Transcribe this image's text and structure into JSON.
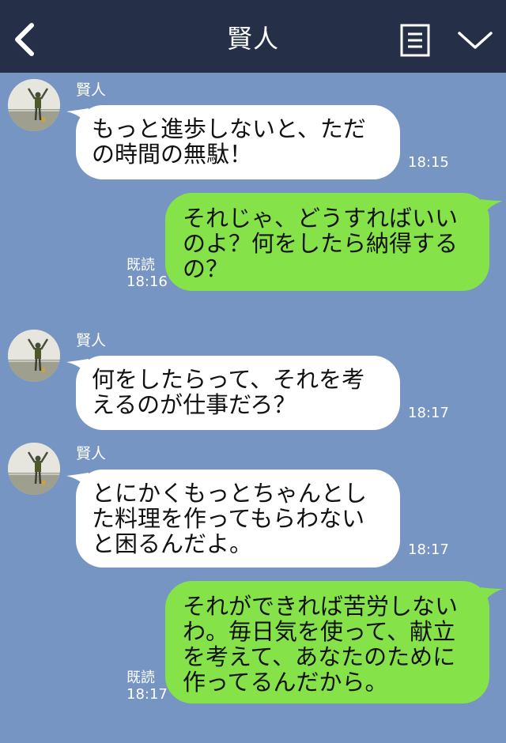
{
  "header": {
    "title": "賢人",
    "back_icon": "chevron-left-icon",
    "menu_icon": "note-icon",
    "expand_icon": "chevron-down-icon"
  },
  "colors": {
    "header_bg": "#253048",
    "chat_bg": "#7695c2",
    "incoming_bubble": "#ffffff",
    "outgoing_bubble": "#85e249"
  },
  "messages": [
    {
      "direction": "incoming",
      "sender": "賢人",
      "text": "もっと進歩しないと、ただ\nの時間の無駄！",
      "time": "18:15"
    },
    {
      "direction": "outgoing",
      "read": "既読",
      "text": "それじゃ、どうすればいい\nのよ？何をしたら納得する\nの？",
      "time": "18:16"
    },
    {
      "direction": "incoming",
      "sender": "賢人",
      "text": "何をしたらって、それを考\nえるのが仕事だろ？",
      "time": "18:17"
    },
    {
      "direction": "incoming",
      "sender": "賢人",
      "text": "とにかくもっとちゃんとし\nた料理を作ってもらわない\nと困るんだよ。",
      "time": "18:17"
    },
    {
      "direction": "outgoing",
      "read": "既読",
      "text": "それができれば苦労しない\nわ。毎日気を使って、献立\nを考えて、あなたのために\n作ってるんだから。",
      "time": "18:17"
    }
  ]
}
